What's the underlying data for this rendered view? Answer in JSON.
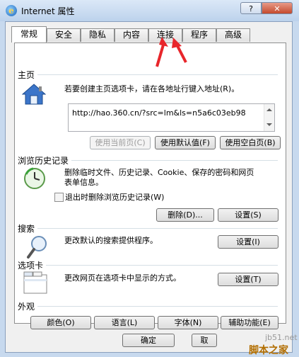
{
  "window": {
    "title": "Internet 属性",
    "help_label": "?",
    "close_label": "✕"
  },
  "tabs": [
    "常规",
    "安全",
    "隐私",
    "内容",
    "连接",
    "程序",
    "高级"
  ],
  "active_tab_index": 0,
  "home_page": {
    "title": "主页",
    "description": "若要创建主页选项卡，请在各地址行键入地址(R)。",
    "url": "http://hao.360.cn/?src=lm&ls=n5a6c03eb98",
    "buttons": {
      "use_current": "使用当前页(C)",
      "use_default": "使用默认值(F)",
      "use_blank": "使用空白页(B)"
    }
  },
  "browsing_history": {
    "title": "浏览历史记录",
    "description_line1": "删除临时文件、历史记录、Cookie、保存的密码和网页",
    "description_line2": "表单信息。",
    "checkbox_label": "退出时删除浏览历史记录(W)",
    "checkbox_checked": false,
    "buttons": {
      "delete": "删除(D)...",
      "settings": "设置(S)"
    }
  },
  "search": {
    "title": "搜索",
    "description": "更改默认的搜索提供程序。",
    "buttons": {
      "settings": "设置(I)"
    }
  },
  "tabs_section": {
    "title": "选项卡",
    "description": "更改网页在选项卡中显示的方式。",
    "buttons": {
      "settings": "设置(T)"
    }
  },
  "appearance": {
    "title": "外观",
    "buttons": {
      "colors": "颜色(O)",
      "languages": "语言(L)",
      "fonts": "字体(N)",
      "accessibility": "辅助功能(E)"
    }
  },
  "footer": {
    "ok": "确定",
    "cancel": "取"
  },
  "annotation_color": "#e8262b",
  "watermark": {
    "en": "jb51.net",
    "cn": "脚本之家"
  }
}
